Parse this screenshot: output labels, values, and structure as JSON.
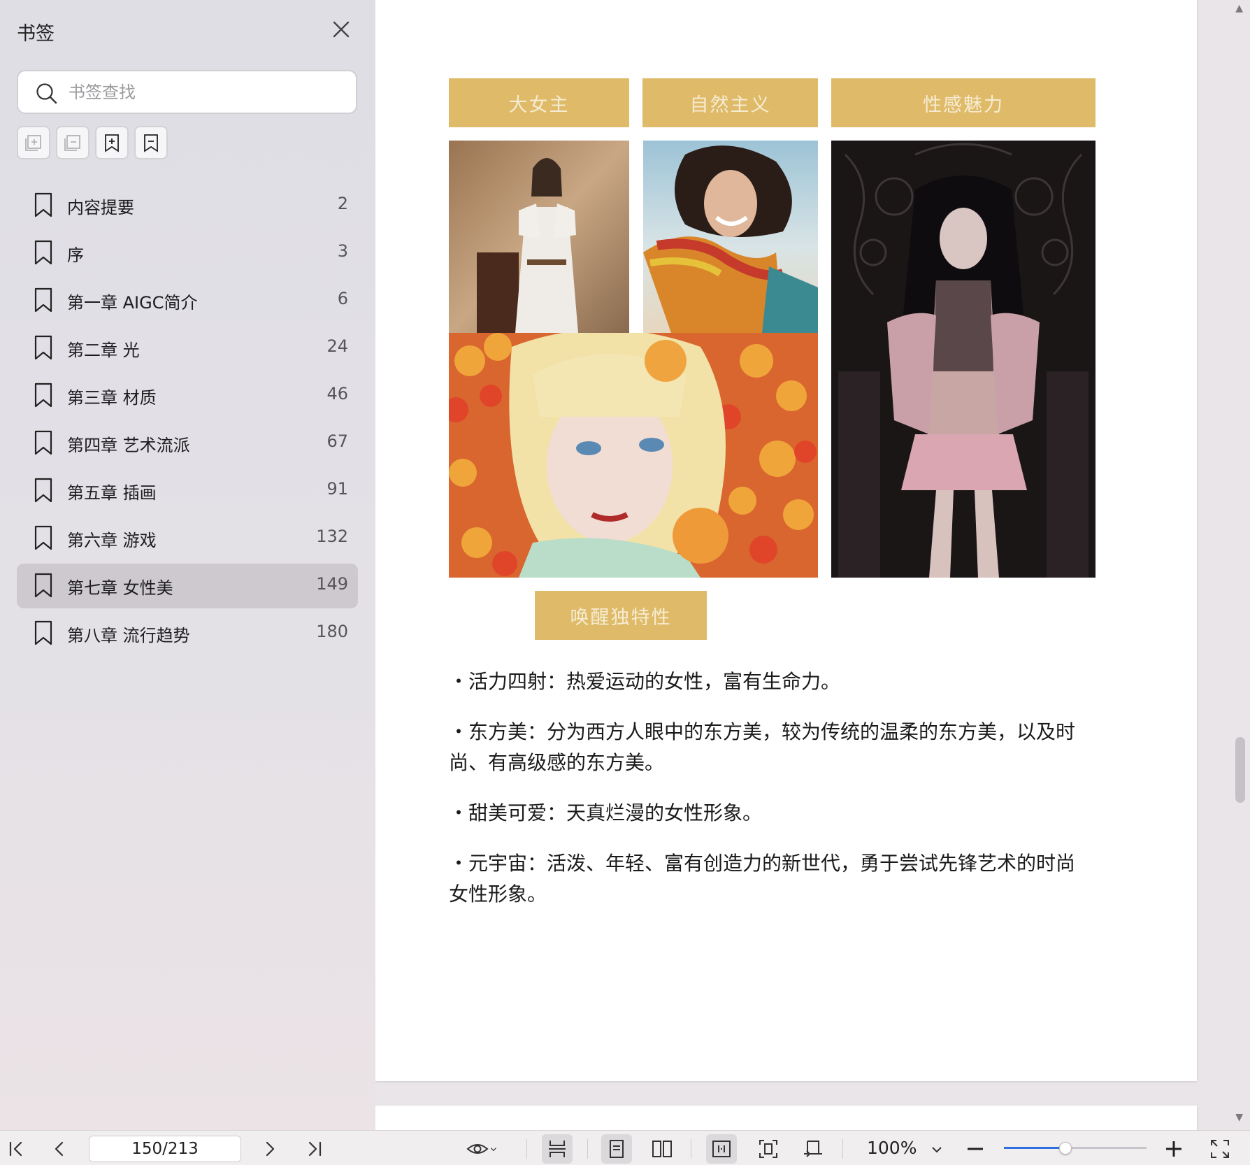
{
  "sidebar": {
    "title": "书签",
    "search_placeholder": "书签查找",
    "items": [
      {
        "label": "内容提要",
        "page": "2"
      },
      {
        "label": "序",
        "page": "3"
      },
      {
        "label": "第一章 AIGC简介",
        "page": "6"
      },
      {
        "label": "第二章 光",
        "page": "24"
      },
      {
        "label": "第三章 材质",
        "page": "46"
      },
      {
        "label": "第四章 艺术流派",
        "page": "67"
      },
      {
        "label": "第五章 插画",
        "page": "91"
      },
      {
        "label": "第六章 游戏",
        "page": "132"
      },
      {
        "label": "第七章 女性美",
        "page": "149"
      },
      {
        "label": "第八章 流行趋势",
        "page": "180"
      }
    ],
    "active_index": 8
  },
  "document": {
    "tags": {
      "t1": "大女主",
      "t2": "自然主义",
      "t3": "性感魅力",
      "t4": "唤醒独特性"
    },
    "bullets": [
      "・活力四射：热爱运动的女性，富有生命力。",
      "・东方美：分为西方人眼中的东方美，较为传统的温柔的东方美，以及时尚、有高级感的东方美。",
      "・甜美可爱：天真烂漫的女性形象。",
      "・元宇宙：活泼、年轻、富有创造力的新世代，勇于尝试先锋艺术的时尚女性形象。"
    ]
  },
  "toolbar": {
    "page_indicator": "150/213",
    "zoom": "100%",
    "zoom_slider_fraction": 0.43
  },
  "colors": {
    "tag_bg": "#dfba68",
    "accent": "#2f6fe0",
    "active_bookmark_bg": "#cdc9ce"
  }
}
